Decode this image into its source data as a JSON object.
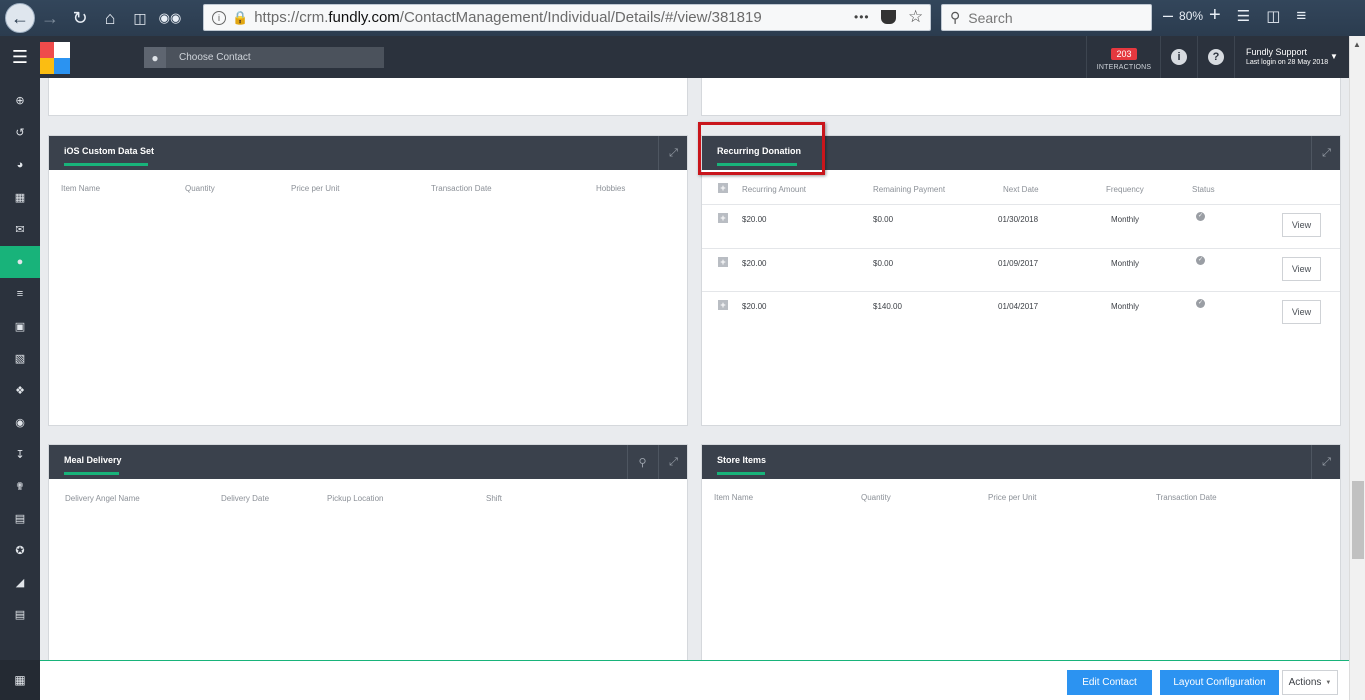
{
  "browser": {
    "url_prefix": "https://crm.",
    "url_domain": "fundly.com",
    "url_path": "/ContactManagement/Individual/Details/#/view/381819",
    "search_placeholder": "Search",
    "zoom": "80%"
  },
  "header": {
    "choose_contact": "Choose Contact",
    "interactions_count": "203",
    "interactions_label": "INTERACTIONS",
    "user_name": "Fundly Support",
    "last_login": "Last login on 28 May 2018",
    "logo_colors": [
      "#ef4b4b",
      "#ffffff",
      "#fbbd12",
      "#2b93f1"
    ]
  },
  "panels": {
    "ios": {
      "title": "iOS Custom Data Set",
      "columns": [
        "Item Name",
        "Quantity",
        "Price per Unit",
        "Transaction Date",
        "Hobbies"
      ]
    },
    "recurring": {
      "title": "Recurring Donation",
      "columns": [
        "Recurring Amount",
        "Remaining Payment",
        "Next Date",
        "Frequency",
        "Status"
      ],
      "rows": [
        {
          "amount": "$20.00",
          "remaining": "$0.00",
          "next_date": "01/30/2018",
          "frequency": "Monthly",
          "view": "View"
        },
        {
          "amount": "$20.00",
          "remaining": "$0.00",
          "next_date": "01/09/2017",
          "frequency": "Monthly",
          "view": "View"
        },
        {
          "amount": "$20.00",
          "remaining": "$140.00",
          "next_date": "01/04/2017",
          "frequency": "Monthly",
          "view": "View"
        }
      ]
    },
    "meal": {
      "title": "Meal Delivery",
      "columns": [
        "Delivery Angel Name",
        "Delivery Date",
        "Pickup Location",
        "Shift"
      ]
    },
    "store": {
      "title": "Store Items",
      "columns": [
        "Item Name",
        "Quantity",
        "Price per Unit",
        "Transaction Date"
      ]
    }
  },
  "footer": {
    "edit_contact": "Edit Contact",
    "layout_configuration": "Layout Configuration",
    "actions": "Actions"
  },
  "colors": {
    "accent_green": "#18b37a",
    "header_dark": "#2b323d",
    "primary_blue": "#2c93f1",
    "highlight_red": "#c9151b"
  }
}
